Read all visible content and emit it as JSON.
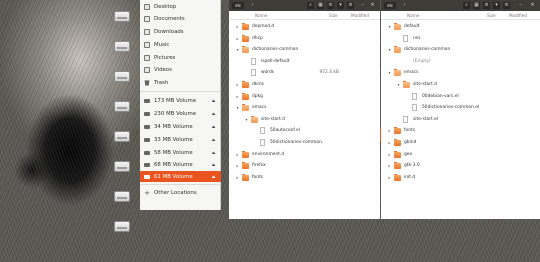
{
  "sidebar": {
    "items": [
      {
        "label": "Desktop",
        "icon": "folder-icon"
      },
      {
        "label": "Documents",
        "icon": "folder-icon"
      },
      {
        "label": "Downloads",
        "icon": "folder-icon"
      },
      {
        "label": "Music",
        "icon": "folder-icon"
      },
      {
        "label": "Pictures",
        "icon": "folder-icon"
      },
      {
        "label": "Videos",
        "icon": "folder-icon"
      },
      {
        "label": "Trash",
        "icon": "trash-icon"
      }
    ],
    "volumes": [
      {
        "label": "173 MB Volume"
      },
      {
        "label": "230 MB Volume"
      },
      {
        "label": "34 MB Volume"
      },
      {
        "label": "33 MB Volume"
      },
      {
        "label": "58 MB Volume"
      },
      {
        "label": "68 MB Volume"
      },
      {
        "label": "61 MB Volume",
        "active": true
      }
    ],
    "other_locations": "Other Locations",
    "eject_glyph": "⏏",
    "plus_glyph": "+"
  },
  "pane1": {
    "crumb": "etc",
    "columns": {
      "name": "Name",
      "size": "Size",
      "modified": "Modified"
    },
    "rows": [
      {
        "name": "depmod.d",
        "size": "",
        "modified": "",
        "type": "folder"
      },
      {
        "name": "dhcp",
        "size": "",
        "modified": "",
        "type": "folder"
      },
      {
        "name": "dictionaries-common",
        "size": "",
        "modified": "",
        "type": "folder"
      },
      {
        "name": "ispell-default",
        "size": "",
        "modified": "",
        "type": "file"
      },
      {
        "name": "words",
        "size": "972.4 kB",
        "modified": "",
        "type": "file"
      },
      {
        "name": "dkms",
        "size": "",
        "modified": "",
        "type": "folder"
      },
      {
        "name": "dpkg",
        "size": "",
        "modified": "",
        "type": "folder"
      },
      {
        "name": "emacs",
        "size": "",
        "modified": "",
        "type": "folder"
      },
      {
        "name": "site-start.d",
        "size": "",
        "modified": "",
        "type": "folder"
      },
      {
        "name": "50autoconf.el",
        "size": "",
        "modified": "",
        "type": "file"
      },
      {
        "name": "50dictionaries-common.el",
        "size": "",
        "modified": "",
        "type": "file"
      },
      {
        "name": "environment.d",
        "size": "",
        "modified": "",
        "type": "folder"
      },
      {
        "name": "firefox",
        "size": "",
        "modified": "",
        "type": "folder"
      },
      {
        "name": "fonts",
        "size": "",
        "modified": "",
        "type": "folder"
      }
    ]
  },
  "pane2": {
    "crumb": "etc",
    "columns": {
      "name": "Name",
      "size": "Size",
      "modified": "Modified"
    },
    "rows": [
      {
        "name": "default",
        "size": "",
        "modified": "",
        "type": "folder"
      },
      {
        "name": "nss",
        "size": "",
        "modified": "",
        "type": "file"
      },
      {
        "name": "dictionaries-common",
        "size": "",
        "modified": "",
        "type": "folder"
      },
      {
        "name": "(Empty)",
        "size": "",
        "modified": "",
        "type": "none"
      },
      {
        "name": "emacs",
        "size": "",
        "modified": "",
        "type": "folder"
      },
      {
        "name": "site-start.d",
        "size": "",
        "modified": "",
        "type": "folder"
      },
      {
        "name": "00debian-vars.el",
        "size": "",
        "modified": "",
        "type": "file"
      },
      {
        "name": "50dictionaries-common.el",
        "size": "",
        "modified": "",
        "type": "file"
      },
      {
        "name": "site-start.el",
        "size": "",
        "modified": "",
        "type": "file"
      },
      {
        "name": "fonts",
        "size": "",
        "modified": "",
        "type": "folder"
      },
      {
        "name": "gbind",
        "size": "",
        "modified": "",
        "type": "folder"
      },
      {
        "name": "geo",
        "size": "",
        "modified": "",
        "type": "folder"
      },
      {
        "name": "gtk-3.0",
        "size": "",
        "modified": "",
        "type": "folder"
      },
      {
        "name": "init.d",
        "size": "",
        "modified": "",
        "type": "folder"
      }
    ]
  },
  "colors": {
    "accent": "#e9541f",
    "folder": "#f08a3e",
    "header": "#3d3c37"
  }
}
